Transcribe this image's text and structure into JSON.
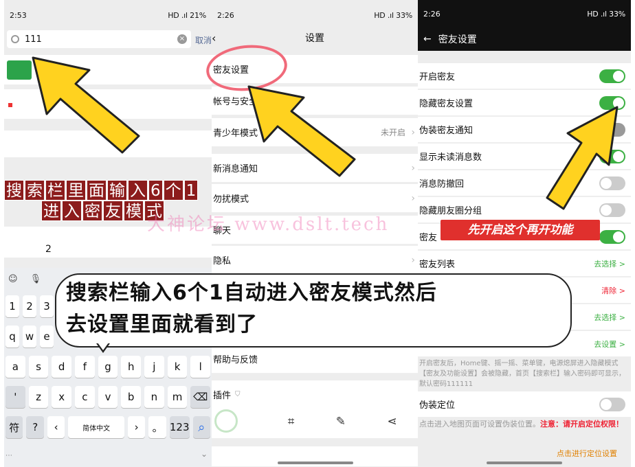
{
  "panel1": {
    "status_time": "2:53",
    "status_right": "HD .ıl 21%",
    "search_value": "111",
    "cancel_label": "取消",
    "result_value": "2",
    "banner_line1": [
      "搜",
      "索",
      "栏",
      "里",
      "面",
      "输",
      "入",
      "6",
      "个",
      "1"
    ],
    "banner_line2": [
      "进",
      "入",
      "密",
      "友",
      "模",
      "式"
    ],
    "keyboard": {
      "row_digits": [
        "1",
        "2",
        "3"
      ],
      "row_q": [
        "q",
        "w",
        "e"
      ],
      "row_a": [
        "a",
        "s",
        "d",
        "f",
        "g",
        "h",
        "j",
        "k",
        "l"
      ],
      "row_z": [
        "'",
        "z",
        "x",
        "c",
        "v",
        "b",
        "n",
        "m",
        "⌫"
      ],
      "row_bottom": [
        "符",
        "?",
        "‹",
        "简体中文",
        "›",
        "。",
        "123",
        "⌕"
      ]
    }
  },
  "panel2": {
    "status_time": "2:26",
    "status_right": "HD .ıl 33%",
    "title": "设置",
    "items": [
      {
        "label": "密友设置"
      },
      {
        "label": "帐号与安全"
      },
      {
        "label": "青少年模式",
        "value": "未开启"
      },
      {
        "label": "新消息通知"
      },
      {
        "label": "勿扰模式"
      },
      {
        "label": "聊天"
      },
      {
        "label": "隐私"
      },
      {
        "label": "帮助与反馈"
      },
      {
        "label": "插件"
      }
    ]
  },
  "panel3": {
    "status_time": "2:26",
    "status_right": "HD .ıl 33%",
    "title": "密友设置",
    "items": [
      {
        "label": "开启密友"
      },
      {
        "label": "隐藏密友设置"
      },
      {
        "label": "伪装密友通知"
      },
      {
        "label": "显示未读消息数"
      },
      {
        "label": "消息防撤回"
      },
      {
        "label": "隐藏朋友圈分组"
      },
      {
        "label": "密友"
      },
      {
        "label": "密友列表",
        "link": "去选择 >"
      },
      {
        "link": "清除 >"
      },
      {
        "link": "去选择 >"
      },
      {
        "link": "去设置 >"
      }
    ],
    "description": "开启密友后，Home键、摇一摇、菜单键，电源熄屏进入隐藏模式【密友及功能设置】会被隐藏，首页【搜索栏】输入密码即可显示，默认密码111111",
    "fake_location_label": "伪装定位",
    "location_desc": "点击进入地图页面可设置伪装位置。",
    "location_warn": "注意：请开启定位权限！",
    "location_link": "点击进行定位设置",
    "red_banner": "先开启这个再开功能"
  },
  "overlay": {
    "watermark": "大神论坛  www.dslt.tech",
    "bubble_line1": "搜索栏输入6个1自动进入密友模式然后",
    "bubble_line2": "去设置里面就看到了"
  }
}
